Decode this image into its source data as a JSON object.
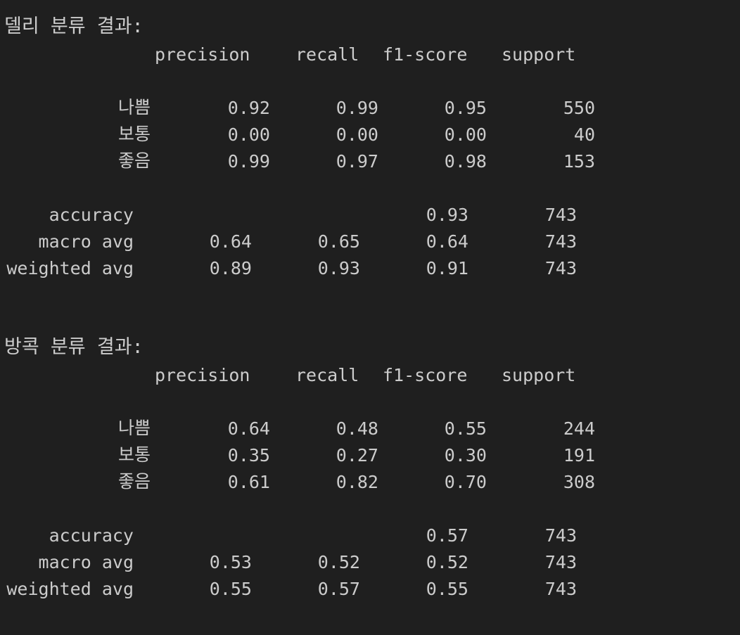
{
  "reports": [
    {
      "title": "델리 분류 결과:",
      "headers": [
        "precision",
        "recall",
        "f1-score",
        "support"
      ],
      "classes": [
        {
          "label": "나쁨",
          "precision": "0.92",
          "recall": "0.99",
          "f1": "0.95",
          "support": "550"
        },
        {
          "label": "보통",
          "precision": "0.00",
          "recall": "0.00",
          "f1": "0.00",
          "support": "40"
        },
        {
          "label": "좋음",
          "precision": "0.99",
          "recall": "0.97",
          "f1": "0.98",
          "support": "153"
        }
      ],
      "accuracy": {
        "label": "accuracy",
        "f1": "0.93",
        "support": "743"
      },
      "macro": {
        "label": "macro avg",
        "precision": "0.64",
        "recall": "0.65",
        "f1": "0.64",
        "support": "743"
      },
      "weighted": {
        "label": "weighted avg",
        "precision": "0.89",
        "recall": "0.93",
        "f1": "0.91",
        "support": "743"
      }
    },
    {
      "title": "방콕 분류 결과:",
      "headers": [
        "precision",
        "recall",
        "f1-score",
        "support"
      ],
      "classes": [
        {
          "label": "나쁨",
          "precision": "0.64",
          "recall": "0.48",
          "f1": "0.55",
          "support": "244"
        },
        {
          "label": "보통",
          "precision": "0.35",
          "recall": "0.27",
          "f1": "0.30",
          "support": "191"
        },
        {
          "label": "좋음",
          "precision": "0.61",
          "recall": "0.82",
          "f1": "0.70",
          "support": "308"
        }
      ],
      "accuracy": {
        "label": "accuracy",
        "f1": "0.57",
        "support": "743"
      },
      "macro": {
        "label": "macro avg",
        "precision": "0.53",
        "recall": "0.52",
        "f1": "0.52",
        "support": "743"
      },
      "weighted": {
        "label": "weighted avg",
        "precision": "0.55",
        "recall": "0.57",
        "f1": "0.55",
        "support": "743"
      }
    }
  ]
}
